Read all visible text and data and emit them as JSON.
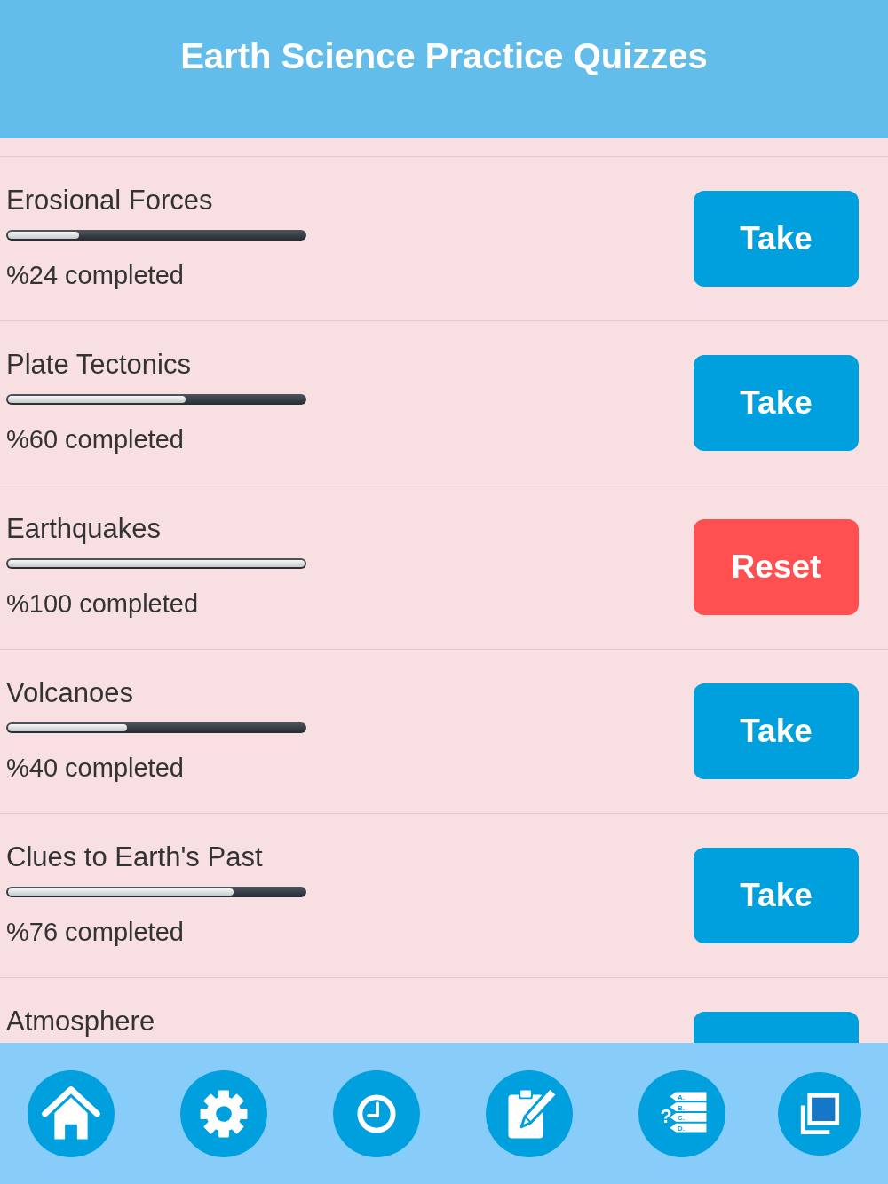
{
  "header": {
    "title": "Earth Science Practice Quizzes"
  },
  "quizzes": [
    {
      "title": "Erosional Forces",
      "level": 0.24,
      "progress": "%24 completed",
      "action": {
        "kind": "take",
        "label": "Take"
      }
    },
    {
      "title": "Plate Tectonics",
      "level": 0.6,
      "progress": "%60 completed",
      "action": {
        "kind": "take",
        "label": "Take"
      }
    },
    {
      "title": "Earthquakes",
      "level": 1,
      "progress": "%100 completed",
      "action": {
        "kind": "reset",
        "label": "Reset"
      }
    },
    {
      "title": "Volcanoes",
      "level": 0.4,
      "progress": "%40 completed",
      "action": {
        "kind": "take",
        "label": "Take"
      }
    },
    {
      "title": "Clues to Earth's Past",
      "level": 0.76,
      "progress": "%76 completed",
      "action": {
        "kind": "take",
        "label": "Take"
      }
    },
    {
      "title": "Atmosphere",
      "action": {
        "kind": "take"
      }
    }
  ],
  "nav": [
    {
      "kind": "home"
    },
    {
      "kind": "settings"
    },
    {
      "kind": "history"
    },
    {
      "kind": "notes"
    },
    {
      "kind": "quiz",
      "symbol": "?",
      "options": [
        "A.",
        "B.",
        "C.",
        "D."
      ]
    },
    {
      "kind": "copy"
    }
  ]
}
